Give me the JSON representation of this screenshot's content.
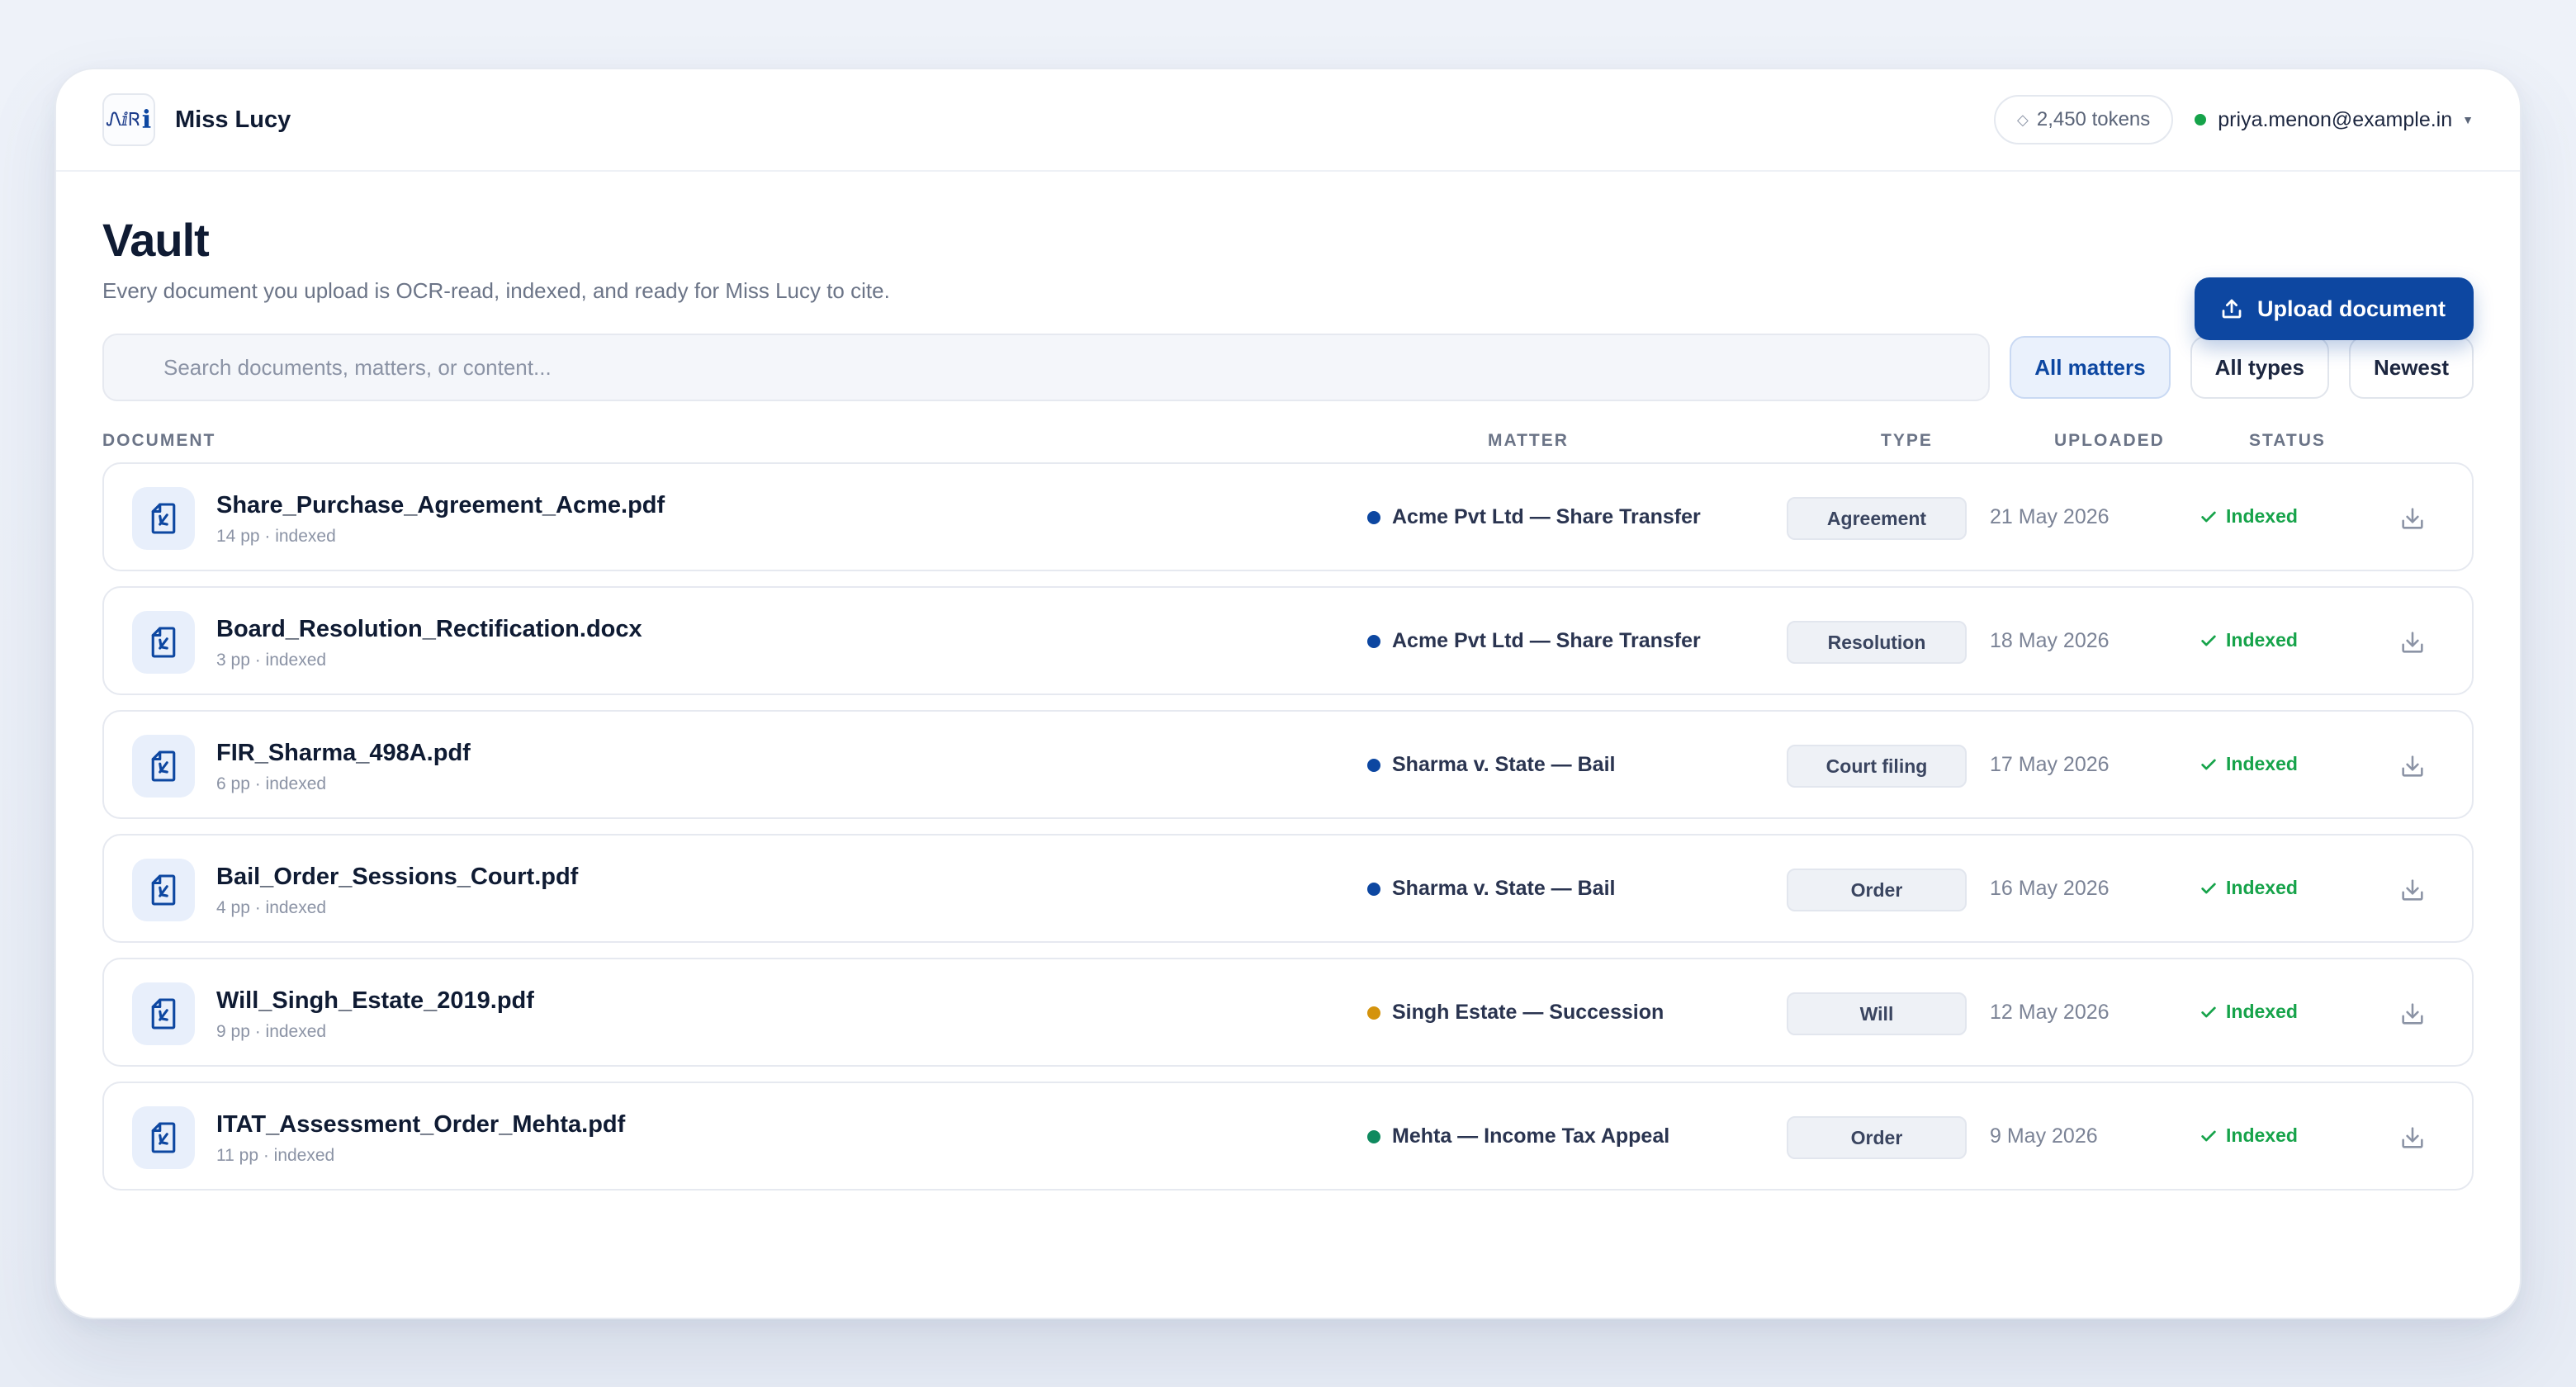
{
  "app": {
    "name": "Miss Lucy",
    "logo_text": "ᏁⅈᏒ",
    "logo_mark": "i"
  },
  "topbar": {
    "tokens": "2,450 tokens",
    "tokens_icon": "diamond-icon",
    "account_email": "priya.menon@example.in",
    "account_status_color": "#16a34a"
  },
  "page": {
    "title": "Vault",
    "subtitle": "Every document you upload is OCR-read, indexed, and ready for Miss Lucy to cite.",
    "upload_label": "Upload document"
  },
  "search": {
    "placeholder": "Search documents, matters, or content..."
  },
  "filters": [
    {
      "label": "All matters",
      "active": true
    },
    {
      "label": "All types",
      "active": false
    },
    {
      "label": "Newest",
      "active": false
    }
  ],
  "columns": {
    "document": "DOCUMENT",
    "matter": "MATTER",
    "type": "TYPE",
    "uploaded": "UPLOADED",
    "status": "STATUS"
  },
  "documents": [
    {
      "name": "Share_Purchase_Agreement_Acme.pdf",
      "meta": "14 pp · indexed",
      "matter": "Acme Pvt Ltd — Share Transfer",
      "matter_color": "#0d47a1",
      "type": "Agreement",
      "uploaded": "21 May 2026",
      "status": "Indexed"
    },
    {
      "name": "Board_Resolution_Rectification.docx",
      "meta": "3 pp · indexed",
      "matter": "Acme Pvt Ltd — Share Transfer",
      "matter_color": "#0d47a1",
      "type": "Resolution",
      "uploaded": "18 May 2026",
      "status": "Indexed"
    },
    {
      "name": "FIR_Sharma_498A.pdf",
      "meta": "6 pp · indexed",
      "matter": "Sharma v. State — Bail",
      "matter_color": "#0d47a1",
      "type": "Court filing",
      "uploaded": "17 May 2026",
      "status": "Indexed"
    },
    {
      "name": "Bail_Order_Sessions_Court.pdf",
      "meta": "4 pp · indexed",
      "matter": "Sharma v. State — Bail",
      "matter_color": "#0d47a1",
      "type": "Order",
      "uploaded": "16 May 2026",
      "status": "Indexed"
    },
    {
      "name": "Will_Singh_Estate_2019.pdf",
      "meta": "9 pp · indexed",
      "matter": "Singh Estate — Succession",
      "matter_color": "#d4930d",
      "type": "Will",
      "uploaded": "12 May 2026",
      "status": "Indexed"
    },
    {
      "name": "ITAT_Assessment_Order_Mehta.pdf",
      "meta": "11 pp · indexed",
      "matter": "Mehta — Income Tax Appeal",
      "matter_color": "#0f8a5f",
      "type": "Order",
      "uploaded": "9 May 2026",
      "status": "Indexed"
    }
  ],
  "colors": {
    "accent": "#0d47a1",
    "success": "#16a34a"
  }
}
